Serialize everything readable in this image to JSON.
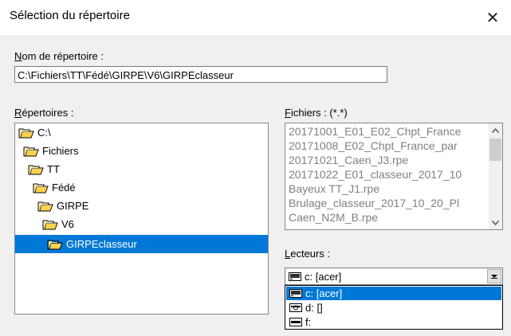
{
  "dialog": {
    "title": "Sélection du répertoire",
    "close_glyph": "✕"
  },
  "path": {
    "label_underlined": "N",
    "label_rest": "om de répertoire :",
    "value": "C:\\Fichiers\\TT\\Fédé\\GIRPE\\V6\\GIRPEclasseur"
  },
  "directories": {
    "label_underlined": "R",
    "label_rest": "épertoires :",
    "items": [
      {
        "label": "C:\\",
        "icon": "open-folder-icon",
        "selected": false
      },
      {
        "label": "Fichiers",
        "icon": "open-folder-icon",
        "selected": false
      },
      {
        "label": "TT",
        "icon": "open-folder-icon",
        "selected": false
      },
      {
        "label": "Fédé",
        "icon": "open-folder-icon",
        "selected": false
      },
      {
        "label": "GIRPE",
        "icon": "open-folder-icon",
        "selected": false
      },
      {
        "label": "V6",
        "icon": "open-folder-icon",
        "selected": false
      },
      {
        "label": "GIRPEclasseur",
        "icon": "open-folder-icon",
        "selected": true
      }
    ]
  },
  "files": {
    "label_underlined": "F",
    "label_rest": "ichiers : (*.*)",
    "items": [
      "20171001_E01_E02_Chpt_France",
      "20171008_E02_Chpt_France_par",
      "20171021_Caen_J3.rpe",
      "20171022_E01_classeur_2017_10",
      "Bayeux TT_J1.rpe",
      "Brulage_classeur_2017_10_20_Pl",
      "Caen_N2M_B.rpe"
    ],
    "scroll_up_icon": "arrow-up-icon",
    "scroll_down_icon": "arrow-down-icon"
  },
  "drives": {
    "label_underlined": "L",
    "label_rest": "ecteurs :",
    "current": "c: [acer]",
    "options": [
      {
        "label": "c: [acer]",
        "icon": "hard-drive-icon",
        "selected": true
      },
      {
        "label": "d: []",
        "icon": "cd-drive-icon",
        "selected": false
      },
      {
        "label": "f:",
        "icon": "removable-drive-icon",
        "selected": false
      }
    ]
  },
  "colors": {
    "selection": "#0078d7",
    "folder_fill": "#ffd96b",
    "disabled_text": "#808080"
  }
}
